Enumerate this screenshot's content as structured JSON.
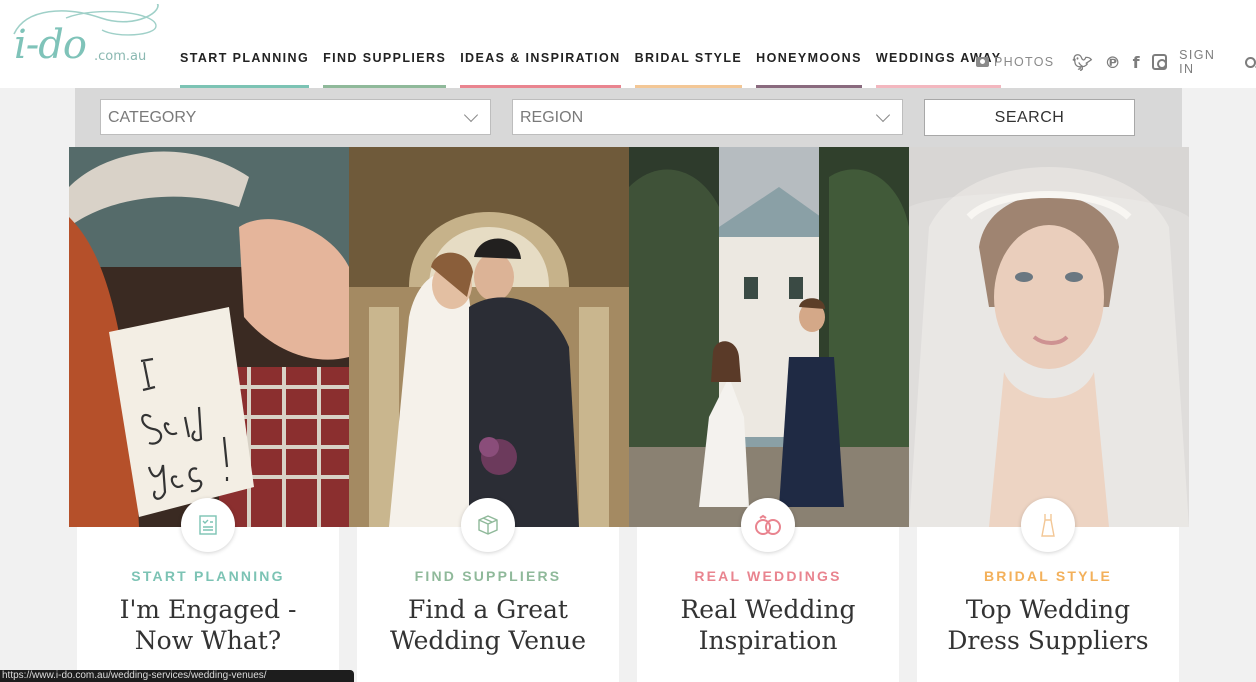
{
  "logo": {
    "main": "i-do",
    "suffix": ".com.au"
  },
  "nav": [
    {
      "label": "START PLANNING",
      "color": "#7cc3b4"
    },
    {
      "label": "FIND SUPPLIERS",
      "color": "#8fb99a"
    },
    {
      "label": "IDEAS & INSPIRATION",
      "color": "#e9848f"
    },
    {
      "label": "BRIDAL STYLE",
      "color": "#f3c796"
    },
    {
      "label": "HONEYMOONS",
      "color": "#8a6a7e"
    },
    {
      "label": "WEDDINGS AWAY",
      "color": "#f3b7bf"
    }
  ],
  "utils": {
    "photos_label": "PHOTOS",
    "twitter_icon": "twitter-icon",
    "pinterest_icon": "pinterest-icon",
    "facebook_icon": "facebook-icon",
    "instagram_icon": "instagram-icon",
    "signin_label": "SIGN IN",
    "search_icon": "search-icon"
  },
  "search": {
    "category_value": "CATEGORY",
    "region_value": "REGION",
    "button_label": "SEARCH"
  },
  "panels": [
    {
      "note_text": "I said yes!"
    }
  ],
  "cards": [
    {
      "category": "START PLANNING",
      "heading": "I'm Engaged - Now What?",
      "color": "#7cc3b4",
      "icon": "checklist-icon"
    },
    {
      "category": "FIND SUPPLIERS",
      "heading": "Find a Great Wedding Venue",
      "color": "#8fb99a",
      "icon": "box-icon"
    },
    {
      "category": "REAL WEDDINGS",
      "heading": "Real Wedding Inspiration",
      "color": "#e9848f",
      "icon": "rings-icon"
    },
    {
      "category": "BRIDAL STYLE",
      "heading": "Top Wedding Dress Suppliers",
      "color": "#f3b05a",
      "icon": "dress-icon"
    }
  ],
  "status_url": "https://www.i-do.com.au/wedding-services/wedding-venues/"
}
